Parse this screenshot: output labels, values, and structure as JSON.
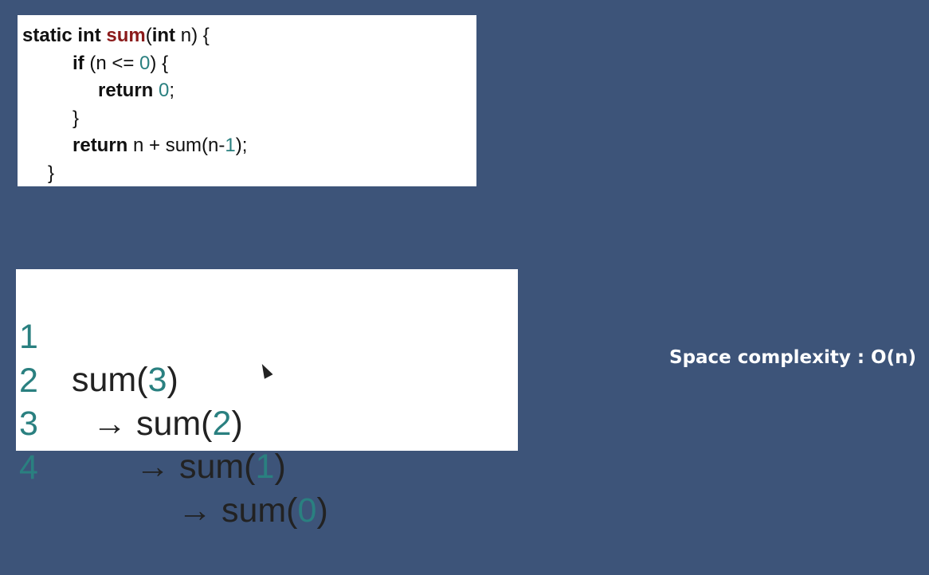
{
  "colors": {
    "background": "#3d5479",
    "keyword_fn": "#8b1a1a",
    "number": "#2a8080",
    "text": "#111111"
  },
  "code": {
    "l1": {
      "a": "static int ",
      "fn": "sum",
      "b": "(",
      "kw": "int",
      "c": " n) {"
    },
    "l2": {
      "kw": "if",
      "a": " (n <= ",
      "num": "0",
      "b": ") {"
    },
    "l3": {
      "kw": "return",
      "a": " ",
      "num": "0",
      "b": ";"
    },
    "l4": {
      "a": "}"
    },
    "l5": {
      "kw": "return",
      "a": " n + sum(n-",
      "num": "1",
      "b": ");"
    },
    "l6": {
      "a": "}"
    }
  },
  "trace": [
    {
      "no": "1",
      "arrow": "",
      "fn": "sum(",
      "arg": "3",
      "close": ")"
    },
    {
      "no": "2",
      "arrow": "→ ",
      "fn": "sum(",
      "arg": "2",
      "close": ")"
    },
    {
      "no": "3",
      "arrow": "→ ",
      "fn": "sum(",
      "arg": "1",
      "close": ")"
    },
    {
      "no": "4",
      "arrow": "→ ",
      "fn": "sum(",
      "arg": "0",
      "close": ")"
    }
  ],
  "space_complexity": "Space complexity : O(n)"
}
